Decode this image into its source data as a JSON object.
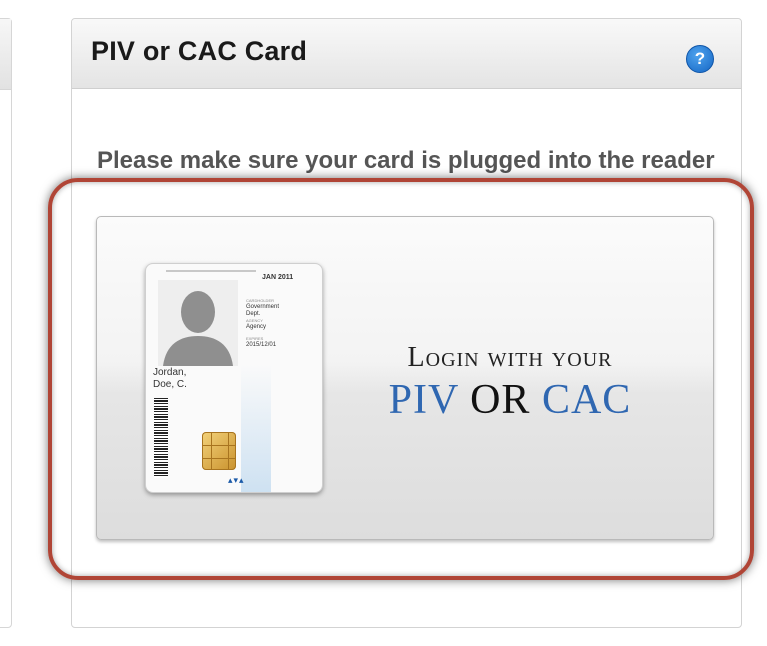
{
  "panel": {
    "title": "PIV or CAC Card",
    "help_icon": "question-mark",
    "help_symbol": "?",
    "instructions": "Please make sure your card is plugged into the reader"
  },
  "login_button": {
    "line1": "Login with your",
    "piv": "PIV",
    "or": "OR",
    "cac": "CAC",
    "accent_color": "#2f67b1"
  },
  "id_card": {
    "date": "JAN 2011",
    "field1_caption": "CARDHOLDER",
    "field1_value_a": "Government",
    "field1_value_b": "Dept.",
    "field2_caption": "AGENCY",
    "field2_value": "Agency",
    "field3_caption": "EXPIRES",
    "field3_value": "2015/12/01",
    "name_line1": "Jordan,",
    "name_line2": "Doe, C."
  },
  "highlight_color": "#b04536"
}
